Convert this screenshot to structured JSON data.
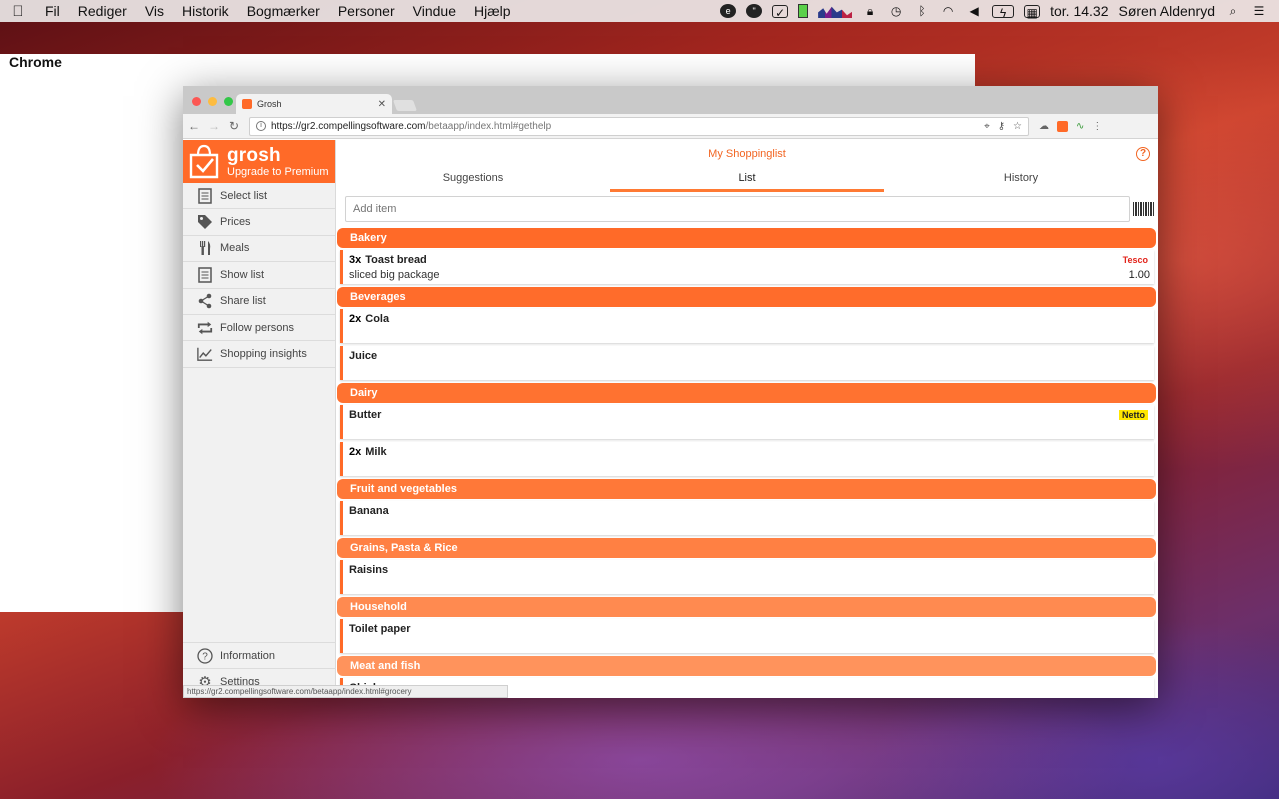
{
  "menubar": {
    "apple": "",
    "app_name": "Chrome",
    "menus": [
      "Fil",
      "Rediger",
      "Vis",
      "Historik",
      "Bogmærker",
      "Personer",
      "Vindue",
      "Hjælp"
    ],
    "clock": "tor. 14.32",
    "user": "Søren Aldenryd",
    "status_icons": [
      "evernote-icon",
      "hangouts-icon",
      "check-icon",
      "battery-widget-icon",
      "activity-graph-icon",
      "lock-icon",
      "time-machine-icon",
      "bluetooth-icon",
      "wifi-icon",
      "volume-icon",
      "battery-icon",
      "calendar-icon",
      "search-icon",
      "list-icon"
    ]
  },
  "browser": {
    "tab_title": "Grosh",
    "url_host": "https://gr2.compellingsoftware.com",
    "url_path": "/betaapp/index.html#gethelp",
    "status_url": "https://gr2.compellingsoftware.com/betaapp/index.html#grocery"
  },
  "sidebar": {
    "brand": "grosh",
    "upgrade": "Upgrade to Premium",
    "items": [
      {
        "label": "Select list",
        "icon": "document-list-icon"
      },
      {
        "label": "Prices",
        "icon": "tag-icon"
      },
      {
        "label": "Meals",
        "icon": "fork-knife-icon"
      },
      {
        "label": "Show list",
        "icon": "document-icon"
      },
      {
        "label": "Share list",
        "icon": "share-icon"
      },
      {
        "label": "Follow persons",
        "icon": "repeat-icon"
      },
      {
        "label": "Shopping insights",
        "icon": "trend-chart-icon"
      }
    ],
    "bottom_items": [
      {
        "label": "Information",
        "icon": "help-circle-icon"
      },
      {
        "label": "Settings",
        "icon": "gear-icon"
      }
    ]
  },
  "main": {
    "title": "My Shoppinglist",
    "tabs": [
      "Suggestions",
      "List",
      "History"
    ],
    "active_tab": "List",
    "add_placeholder": "Add item",
    "accent_color": "#ff6a28",
    "categories": [
      {
        "name": "Bakery",
        "items": [
          {
            "qty": "3x",
            "name": "Toast bread",
            "note": "sliced big package",
            "store": "Tesco",
            "price": "1.00"
          }
        ]
      },
      {
        "name": "Beverages",
        "items": [
          {
            "qty": "2x",
            "name": "Cola"
          },
          {
            "qty": "",
            "name": "Juice"
          }
        ]
      },
      {
        "name": "Dairy",
        "items": [
          {
            "qty": "",
            "name": "Butter",
            "store": "Netto"
          },
          {
            "qty": "2x",
            "name": "Milk"
          }
        ]
      },
      {
        "name": "Fruit and vegetables",
        "items": [
          {
            "qty": "",
            "name": "Banana"
          }
        ]
      },
      {
        "name": "Grains, Pasta & Rice",
        "items": [
          {
            "qty": "",
            "name": "Raisins"
          }
        ]
      },
      {
        "name": "Household",
        "items": [
          {
            "qty": "",
            "name": "Toilet paper"
          }
        ]
      },
      {
        "name": "Meat and fish",
        "items": [
          {
            "qty": "",
            "name": "Chicken"
          }
        ]
      }
    ]
  }
}
